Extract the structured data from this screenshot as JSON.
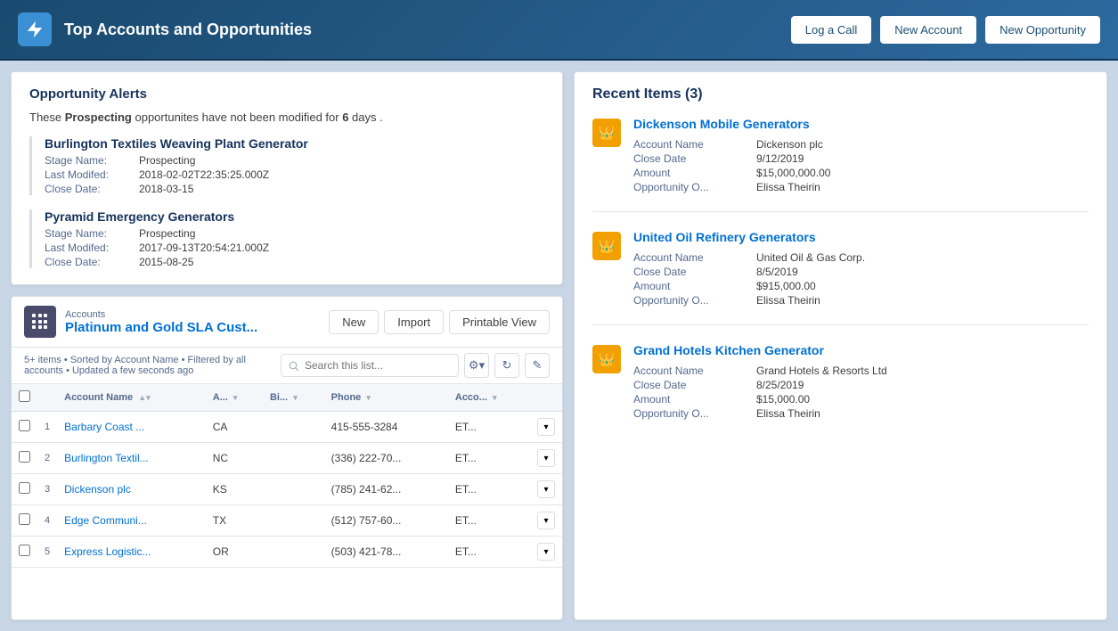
{
  "header": {
    "title": "Top Accounts and Opportunities",
    "buttons": {
      "log_call": "Log a Call",
      "new_account": "New Account",
      "new_opportunity": "New Opportunity"
    }
  },
  "alerts": {
    "title": "Opportunity Alerts",
    "description_prefix": "These ",
    "bold_word": "Prospecting",
    "description_suffix": " opportunites have not been modified for ",
    "days": "6",
    "days_suffix": " days .",
    "items": [
      {
        "name": "Burlington Textiles Weaving Plant Generator",
        "fields": [
          {
            "label": "Stage Name:",
            "value": "Prospecting"
          },
          {
            "label": "Last Modifed:",
            "value": "2018-02-02T22:35:25.000Z"
          },
          {
            "label": "Close Date:",
            "value": "2018-03-15"
          }
        ]
      },
      {
        "name": "Pyramid Emergency Generators",
        "fields": [
          {
            "label": "Stage Name:",
            "value": "Prospecting"
          },
          {
            "label": "Last Modifed:",
            "value": "2017-09-13T20:54:21.000Z"
          },
          {
            "label": "Close Date:",
            "value": "2015-08-25"
          }
        ]
      }
    ]
  },
  "accounts": {
    "subtitle": "Accounts",
    "title": "Platinum and Gold SLA Cust...",
    "meta": "5+ items • Sorted by Account Name • Filtered by all accounts • Updated a few seconds ago",
    "search_placeholder": "Search this list...",
    "buttons": {
      "new": "New",
      "import": "Import",
      "printable_view": "Printable View"
    },
    "columns": [
      {
        "label": "Account Name",
        "key": "account_name",
        "sortable": true
      },
      {
        "label": "A...",
        "key": "state",
        "sortable": true
      },
      {
        "label": "Bi...",
        "key": "billing",
        "sortable": true
      },
      {
        "label": "Phone",
        "key": "phone",
        "sortable": true
      },
      {
        "label": "Acco...",
        "key": "acco",
        "sortable": true
      }
    ],
    "rows": [
      {
        "num": "1",
        "account_name": "Barbary Coast ...",
        "state": "CA",
        "billing": "",
        "phone": "415-555-3284",
        "acco": "ET..."
      },
      {
        "num": "2",
        "account_name": "Burlington Textil...",
        "state": "NC",
        "billing": "",
        "phone": "(336) 222-70...",
        "acco": "ET..."
      },
      {
        "num": "3",
        "account_name": "Dickenson plc",
        "state": "KS",
        "billing": "",
        "phone": "(785) 241-62...",
        "acco": "ET..."
      },
      {
        "num": "4",
        "account_name": "Edge Communi...",
        "state": "TX",
        "billing": "",
        "phone": "(512) 757-60...",
        "acco": "ET..."
      },
      {
        "num": "5",
        "account_name": "Express Logistic...",
        "state": "OR",
        "billing": "",
        "phone": "(503) 421-78...",
        "acco": "ET..."
      }
    ]
  },
  "recent": {
    "title": "Recent Items (3)",
    "items": [
      {
        "name": "Dickenson Mobile Generators",
        "fields": [
          {
            "label": "Account Name",
            "value": "Dickenson plc"
          },
          {
            "label": "Close Date",
            "value": "9/12/2019"
          },
          {
            "label": "Amount",
            "value": "$15,000,000.00"
          },
          {
            "label": "Opportunity O...",
            "value": "Elissa Theirin"
          }
        ]
      },
      {
        "name": "United Oil Refinery Generators",
        "fields": [
          {
            "label": "Account Name",
            "value": "United Oil & Gas Corp."
          },
          {
            "label": "Close Date",
            "value": "8/5/2019"
          },
          {
            "label": "Amount",
            "value": "$915,000.00"
          },
          {
            "label": "Opportunity O...",
            "value": "Elissa Theirin"
          }
        ]
      },
      {
        "name": "Grand Hotels Kitchen Generator",
        "fields": [
          {
            "label": "Account Name",
            "value": "Grand Hotels & Resorts Ltd"
          },
          {
            "label": "Close Date",
            "value": "8/25/2019"
          },
          {
            "label": "Amount",
            "value": "$15,000.00"
          },
          {
            "label": "Opportunity O...",
            "value": "Elissa Theirin"
          }
        ]
      }
    ]
  }
}
